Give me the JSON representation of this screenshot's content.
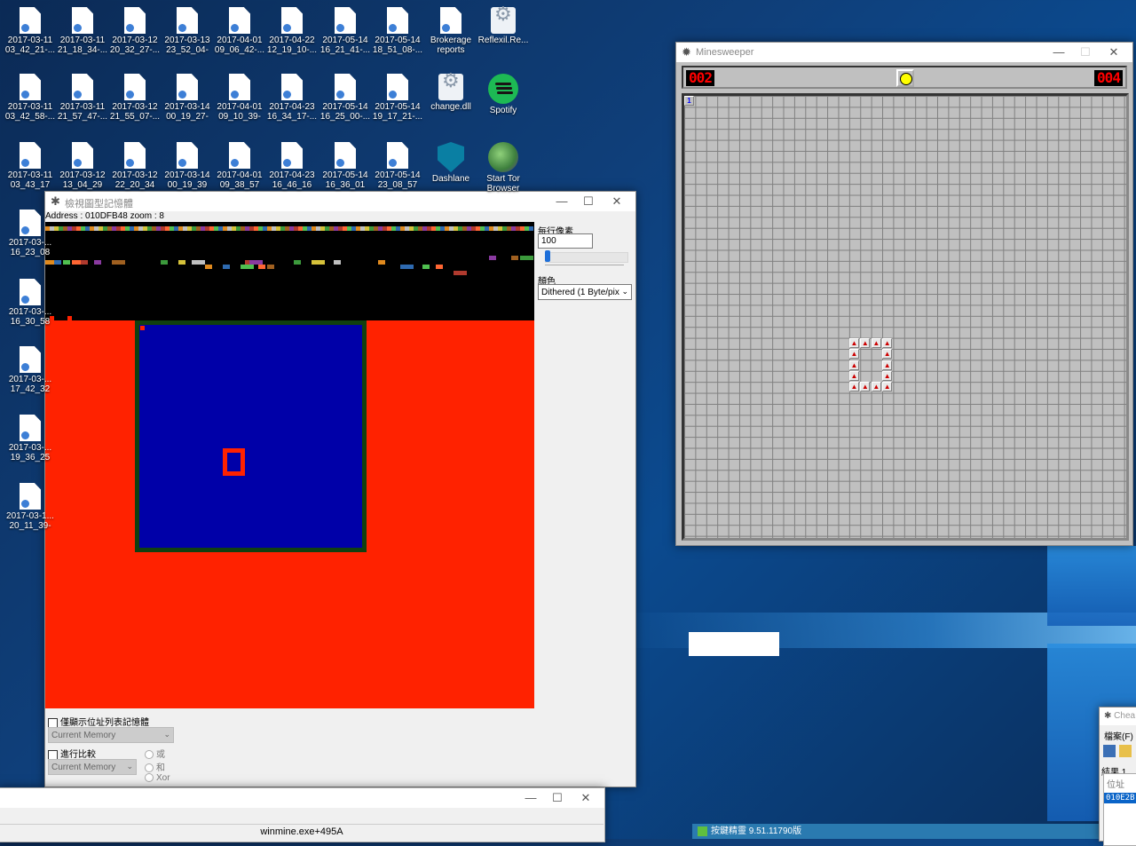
{
  "desktop": {
    "icons_row1": [
      "2017-03-11 03_42_21-...",
      "2017-03-11 21_18_34-...",
      "2017-03-12 20_32_27-...",
      "2017-03-13 23_52_04-",
      "2017-04-01 09_06_42-...",
      "2017-04-22 12_19_10-...",
      "2017-05-14 16_21_41-...",
      "2017-05-14 18_51_08-...",
      "Brokerage reports",
      "Reflexil.Re..."
    ],
    "icons_row2": [
      "2017-03-11 03_42_58-...",
      "2017-03-11 21_57_47-...",
      "2017-03-12 21_55_07-...",
      "2017-03-14 00_19_27-",
      "2017-04-01 09_10_39-",
      "2017-04-23 16_34_17-...",
      "2017-05-14 16_25_00-...",
      "2017-05-14 19_17_21-...",
      "change.dll",
      "Spotify"
    ],
    "icons_row3": [
      "2017-03-11 03_43_17",
      "2017-03-12 13_04_29",
      "2017-03-12 22_20_34",
      "2017-03-14 00_19_39",
      "2017-04-01 09_38_57",
      "2017-04-23 16_46_16",
      "2017-05-14 16_36_01",
      "2017-05-14 23_08_57",
      "Dashlane",
      "Start Tor Browser"
    ],
    "icons_col": [
      "2017-03-... 16_23_08",
      "2017-03-... 16_30_58",
      "2017-03-... 17_42_32",
      "2017-03-... 19_36_25",
      "2017-03-1... 20_11_39-"
    ]
  },
  "memory_viewer": {
    "title": "檢視圖型記憶體",
    "address": "Address : 010DFB48 zoom : 8",
    "pixels_per_row_label": "每行像素",
    "pixels_per_row_value": "100",
    "color_label": "顏色",
    "color_mode": "Dithered (1 Byte/pix",
    "show_only_addr_label": "僅顯示位址列表記憶體",
    "current_memory_1": "Current Memory",
    "compare_label": "進行比較",
    "current_memory_2": "Current Memory",
    "op_or": "或",
    "op_and": "和",
    "op_xor": "Xor"
  },
  "minesweeper": {
    "title": "Minesweeper",
    "mines_counter": "002",
    "timer": "004",
    "corner_cell": "1"
  },
  "bottom_window": {
    "status_text": "winmine.exe+495A"
  },
  "cheat_engine_right": {
    "title": "Chea",
    "menu_file": "檔案(F)",
    "results": "結果 1",
    "address_header": "位址",
    "address_value": "010E2B"
  },
  "taskbar_item": {
    "label": "按鍵精靈 9.51.11790版"
  },
  "colors": {
    "red": "#ff2200",
    "blue": "#0000a8",
    "green_border": "#104010"
  }
}
